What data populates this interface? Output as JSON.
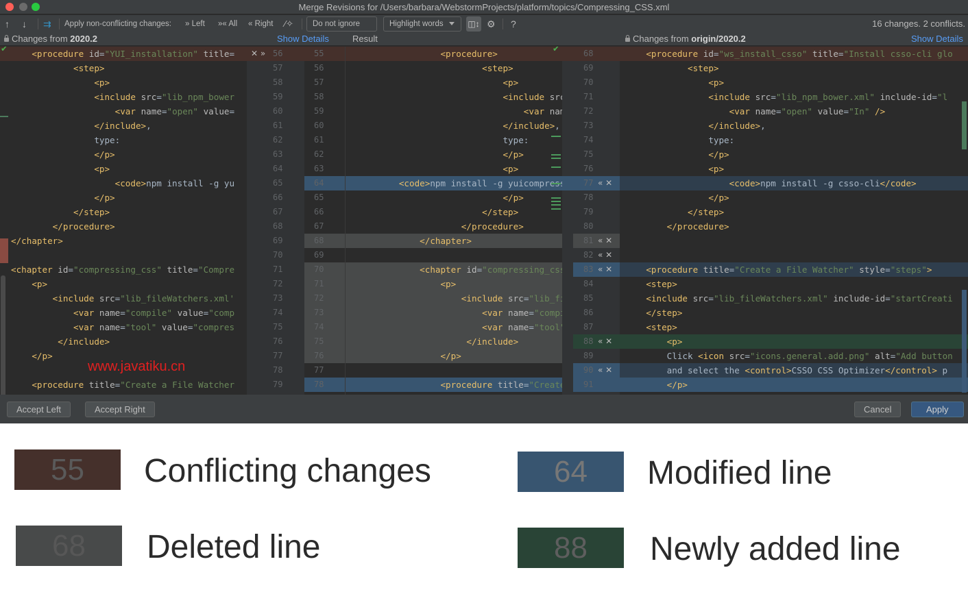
{
  "window": {
    "title": "Merge Revisions for /Users/barbara/WebstormProjects/platform/topics/Compressing_CSS.xml"
  },
  "toolbar": {
    "prev_icon": "arrow-up-icon",
    "next_icon": "arrow-down-icon",
    "magic_resolve_icon": "merge-arrows-icon",
    "apply_label": "Apply non-conflicting changes:",
    "left_label": "Left",
    "all_label": "All",
    "right_label": "Right",
    "wand_icon": "magic-wand-icon",
    "ignore_combo": "Do not ignore",
    "highlight_combo": "Highlight words",
    "sync_scroll_icon": "sync-scroll-icon",
    "settings_icon": "gear-icon",
    "help_label": "?",
    "changes_status": "16 changes. 2 conflicts."
  },
  "headers": {
    "left_prefix": "Changes from ",
    "left_branch": "2020.2",
    "left_show_details": "Show Details",
    "result_label": "Result",
    "right_prefix": "Changes from ",
    "right_branch": "origin/2020.2",
    "right_show_details": "Show Details"
  },
  "left_panel": {
    "lines": [
      {
        "ln": "56",
        "code": [
          [
            "t",
            "    <procedure"
          ],
          [
            "a",
            " id"
          ],
          [
            "p",
            "="
          ],
          [
            "s",
            "\"YUI_installation\""
          ],
          [
            "a",
            " title"
          ],
          [
            "p",
            "="
          ]
        ],
        "bg": "conflict"
      },
      {
        "ln": "57",
        "code": [
          [
            "t",
            "            <step>"
          ]
        ]
      },
      {
        "ln": "58",
        "code": [
          [
            "t",
            "                <p>"
          ]
        ]
      },
      {
        "ln": "59",
        "code": [
          [
            "t",
            "                <include"
          ],
          [
            "a",
            " src"
          ],
          [
            "p",
            "="
          ],
          [
            "s",
            "\"lib_npm_bower"
          ]
        ]
      },
      {
        "ln": "60",
        "code": [
          [
            "t",
            "                    <var"
          ],
          [
            "a",
            " name"
          ],
          [
            "p",
            "="
          ],
          [
            "s",
            "\"open\""
          ],
          [
            "a",
            " value"
          ],
          [
            "p",
            "="
          ]
        ]
      },
      {
        "ln": "61",
        "code": [
          [
            "t",
            "                </include>"
          ],
          [
            "p",
            ","
          ]
        ]
      },
      {
        "ln": "62",
        "code": [
          [
            "p",
            "                type:"
          ]
        ]
      },
      {
        "ln": "63",
        "code": [
          [
            "t",
            "                </p>"
          ]
        ]
      },
      {
        "ln": "64",
        "code": [
          [
            "t",
            "                <p>"
          ]
        ]
      },
      {
        "ln": "65",
        "code": [
          [
            "t",
            "                    <code>"
          ],
          [
            "p",
            "npm install -g yu"
          ]
        ]
      },
      {
        "ln": "66",
        "code": [
          [
            "t",
            "                </p>"
          ]
        ]
      },
      {
        "ln": "67",
        "code": [
          [
            "t",
            "            </step>"
          ]
        ]
      },
      {
        "ln": "68",
        "code": [
          [
            "t",
            "        </procedure>"
          ]
        ]
      },
      {
        "ln": "69",
        "code": [
          [
            "t",
            "</chapter>"
          ]
        ]
      },
      {
        "ln": "70",
        "code": []
      },
      {
        "ln": "71",
        "code": [
          [
            "t",
            "<chapter"
          ],
          [
            "a",
            " id"
          ],
          [
            "p",
            "="
          ],
          [
            "s",
            "\"compressing_css\""
          ],
          [
            "a",
            " title"
          ],
          [
            "p",
            "="
          ],
          [
            "s",
            "\"Compre"
          ]
        ]
      },
      {
        "ln": "72",
        "code": [
          [
            "t",
            "    <p>"
          ]
        ]
      },
      {
        "ln": "73",
        "code": [
          [
            "t",
            "        <include"
          ],
          [
            "a",
            " src"
          ],
          [
            "p",
            "="
          ],
          [
            "s",
            "\"lib_fileWatchers.xml'"
          ]
        ]
      },
      {
        "ln": "74",
        "code": [
          [
            "t",
            "            <var"
          ],
          [
            "a",
            " name"
          ],
          [
            "p",
            "="
          ],
          [
            "s",
            "\"compile\""
          ],
          [
            "a",
            " value"
          ],
          [
            "p",
            "="
          ],
          [
            "s",
            "\"comp"
          ]
        ]
      },
      {
        "ln": "75",
        "code": [
          [
            "t",
            "            <var"
          ],
          [
            "a",
            " name"
          ],
          [
            "p",
            "="
          ],
          [
            "s",
            "\"tool\""
          ],
          [
            "a",
            " value"
          ],
          [
            "p",
            "="
          ],
          [
            "s",
            "\"compres"
          ]
        ]
      },
      {
        "ln": "76",
        "code": [
          [
            "t",
            "         </include>"
          ]
        ]
      },
      {
        "ln": "77",
        "code": [
          [
            "t",
            "    </p>"
          ]
        ]
      },
      {
        "ln": "78",
        "code": []
      },
      {
        "ln": "79",
        "code": [
          [
            "t",
            "    <procedure"
          ],
          [
            "a",
            " title"
          ],
          [
            "p",
            "="
          ],
          [
            "s",
            "\"Create a File Watcher"
          ]
        ]
      }
    ]
  },
  "mid_panel": {
    "lines": [
      {
        "ln": "55",
        "code": [
          [
            "t",
            "                  <procedure>"
          ]
        ],
        "bg": "conflict"
      },
      {
        "ln": "56",
        "code": [
          [
            "t",
            "                          <step>"
          ]
        ]
      },
      {
        "ln": "57",
        "code": [
          [
            "t",
            "                              <p>"
          ]
        ]
      },
      {
        "ln": "58",
        "code": [
          [
            "t",
            "                              <include"
          ],
          [
            "a",
            " src"
          ],
          [
            "p",
            "="
          ],
          [
            "s",
            "\"l"
          ]
        ]
      },
      {
        "ln": "59",
        "code": [
          [
            "t",
            "                                  <var"
          ],
          [
            "a",
            " name"
          ],
          [
            "p",
            "="
          ],
          [
            "s",
            "\""
          ]
        ]
      },
      {
        "ln": "60",
        "code": [
          [
            "t",
            "                              </include>"
          ],
          [
            "p",
            ","
          ]
        ]
      },
      {
        "ln": "61",
        "code": [
          [
            "p",
            "                              type:"
          ]
        ]
      },
      {
        "ln": "62",
        "code": [
          [
            "t",
            "                              </p>"
          ]
        ]
      },
      {
        "ln": "63",
        "code": [
          [
            "t",
            "                              <p>"
          ]
        ]
      },
      {
        "ln": "64",
        "code": [
          [
            "t",
            "          <code>"
          ],
          [
            "p",
            "npm install -g yuicompressor"
          ],
          [
            "t",
            "</"
          ]
        ],
        "bg": "modified"
      },
      {
        "ln": "65",
        "code": [
          [
            "t",
            "                              </p>"
          ]
        ]
      },
      {
        "ln": "66",
        "code": [
          [
            "t",
            "                          </step>"
          ]
        ]
      },
      {
        "ln": "67",
        "code": [
          [
            "t",
            "                      </procedure>"
          ]
        ]
      },
      {
        "ln": "68",
        "code": [
          [
            "t",
            "              </chapter>"
          ]
        ],
        "bg": "deleted"
      },
      {
        "ln": "69",
        "code": []
      },
      {
        "ln": "70",
        "code": [
          [
            "t",
            "              <chapter"
          ],
          [
            "a",
            " id"
          ],
          [
            "p",
            "="
          ],
          [
            "s",
            "\"compressing_css\""
          ]
        ],
        "bg": "deleted"
      },
      {
        "ln": "71",
        "code": [
          [
            "t",
            "                  <p>"
          ]
        ],
        "bg": "deleted"
      },
      {
        "ln": "72",
        "code": [
          [
            "t",
            "                      <include"
          ],
          [
            "a",
            " src"
          ],
          [
            "p",
            "="
          ],
          [
            "s",
            "\"lib_fileW"
          ]
        ],
        "bg": "deleted"
      },
      {
        "ln": "73",
        "code": [
          [
            "t",
            "                          <var"
          ],
          [
            "a",
            " name"
          ],
          [
            "p",
            "="
          ],
          [
            "s",
            "\"compile\""
          ]
        ],
        "bg": "deleted"
      },
      {
        "ln": "74",
        "code": [
          [
            "t",
            "                          <var"
          ],
          [
            "a",
            " name"
          ],
          [
            "p",
            "="
          ],
          [
            "s",
            "\"tool\""
          ],
          [
            "a",
            " va"
          ]
        ],
        "bg": "deleted"
      },
      {
        "ln": "75",
        "code": [
          [
            "t",
            "                       </include>"
          ]
        ],
        "bg": "deleted"
      },
      {
        "ln": "76",
        "code": [
          [
            "t",
            "                  </p>"
          ]
        ],
        "bg": "deleted"
      },
      {
        "ln": "77",
        "code": []
      },
      {
        "ln": "78",
        "code": [
          [
            "t",
            "                  <procedure"
          ],
          [
            "a",
            " title"
          ],
          [
            "p",
            "="
          ],
          [
            "s",
            "\"Create a"
          ]
        ],
        "bg": "modified"
      }
    ]
  },
  "right_panel": {
    "lines": [
      {
        "ln": "68",
        "code": [
          [
            "t",
            "    <procedure"
          ],
          [
            "a",
            " id"
          ],
          [
            "p",
            "="
          ],
          [
            "s",
            "\"ws_install_csso\""
          ],
          [
            "a",
            " title"
          ],
          [
            "p",
            "="
          ],
          [
            "s",
            "\"Install csso-cli glo"
          ]
        ],
        "bg": "conflict"
      },
      {
        "ln": "69",
        "code": [
          [
            "t",
            "            <step>"
          ]
        ]
      },
      {
        "ln": "70",
        "code": [
          [
            "t",
            "                <p>"
          ]
        ]
      },
      {
        "ln": "71",
        "code": [
          [
            "t",
            "                <include"
          ],
          [
            "a",
            " src"
          ],
          [
            "p",
            "="
          ],
          [
            "s",
            "\"lib_npm_bower.xml\""
          ],
          [
            "a",
            " include-id"
          ],
          [
            "p",
            "="
          ],
          [
            "s",
            "\"l"
          ]
        ]
      },
      {
        "ln": "72",
        "code": [
          [
            "t",
            "                    <var"
          ],
          [
            "a",
            " name"
          ],
          [
            "p",
            "="
          ],
          [
            "s",
            "\"open\""
          ],
          [
            "a",
            " value"
          ],
          [
            "p",
            "="
          ],
          [
            "s",
            "\"In\""
          ],
          [
            "t",
            " />"
          ]
        ]
      },
      {
        "ln": "73",
        "code": [
          [
            "t",
            "                </include>"
          ],
          [
            "p",
            ","
          ]
        ]
      },
      {
        "ln": "74",
        "code": [
          [
            "p",
            "                type:"
          ]
        ]
      },
      {
        "ln": "75",
        "code": [
          [
            "t",
            "                </p>"
          ]
        ]
      },
      {
        "ln": "76",
        "code": [
          [
            "t",
            "                <p>"
          ]
        ]
      },
      {
        "ln": "77",
        "code": [
          [
            "t",
            "                    <code>"
          ],
          [
            "p",
            "npm install -g csso-cli"
          ],
          [
            "t",
            "</code>"
          ]
        ],
        "bg": "modified-soft"
      },
      {
        "ln": "78",
        "code": [
          [
            "t",
            "                </p>"
          ]
        ]
      },
      {
        "ln": "79",
        "code": [
          [
            "t",
            "            </step>"
          ]
        ]
      },
      {
        "ln": "80",
        "code": [
          [
            "t",
            "        </procedure>"
          ]
        ]
      },
      {
        "ln": "81",
        "code": []
      },
      {
        "ln": "82",
        "code": []
      },
      {
        "ln": "83",
        "code": [
          [
            "t",
            "    <procedure"
          ],
          [
            "a",
            " title"
          ],
          [
            "p",
            "="
          ],
          [
            "s",
            "\"Create a File Watcher\""
          ],
          [
            "a",
            " style"
          ],
          [
            "p",
            "="
          ],
          [
            "s",
            "\"steps\""
          ],
          [
            "t",
            ">"
          ]
        ],
        "bg": "modified-soft"
      },
      {
        "ln": "84",
        "code": [
          [
            "t",
            "    <step>"
          ]
        ]
      },
      {
        "ln": "85",
        "code": [
          [
            "t",
            "    <include"
          ],
          [
            "a",
            " src"
          ],
          [
            "p",
            "="
          ],
          [
            "s",
            "\"lib_fileWatchers.xml\""
          ],
          [
            "a",
            " include-id"
          ],
          [
            "p",
            "="
          ],
          [
            "s",
            "\"startCreati"
          ]
        ]
      },
      {
        "ln": "86",
        "code": [
          [
            "t",
            "    </step>"
          ]
        ]
      },
      {
        "ln": "87",
        "code": [
          [
            "t",
            "    <step>"
          ]
        ]
      },
      {
        "ln": "88",
        "code": [
          [
            "t",
            "        <p>"
          ]
        ],
        "bg": "added"
      },
      {
        "ln": "89",
        "code": [
          [
            "p",
            "        Click "
          ],
          [
            "t",
            "<icon"
          ],
          [
            "a",
            " src"
          ],
          [
            "p",
            "="
          ],
          [
            "s",
            "\"icons.general.add.png\""
          ],
          [
            "a",
            " alt"
          ],
          [
            "p",
            "="
          ],
          [
            "s",
            "\"Add button"
          ]
        ]
      },
      {
        "ln": "90",
        "code": [
          [
            "p",
            "        and select the "
          ],
          [
            "t",
            "<control>"
          ],
          [
            "p",
            "CSSO CSS Optimizer"
          ],
          [
            "t",
            "</control>"
          ],
          [
            "p",
            " p"
          ]
        ],
        "bg": "modified-soft"
      },
      {
        "ln": "91",
        "code": [
          [
            "t",
            "        </p>"
          ]
        ],
        "bg": "modified"
      }
    ]
  },
  "left_gutter_controls": [
    {
      "row": 0,
      "label": "✕ »"
    }
  ],
  "right_gutter_controls": [
    {
      "row": 9,
      "label": "« ✕"
    },
    {
      "row": 13,
      "label": "« ✕"
    },
    {
      "row": 14,
      "label": "« ✕"
    },
    {
      "row": 15,
      "label": "« ✕"
    },
    {
      "row": 20,
      "label": "« ✕"
    },
    {
      "row": 22,
      "label": "« ✕"
    }
  ],
  "buttons": {
    "accept_left": "Accept Left",
    "accept_right": "Accept Right",
    "cancel": "Cancel",
    "apply": "Apply"
  },
  "watermark": "www.javatiku.cn",
  "colors": {
    "conflict": "#45302b",
    "modified": "#385570",
    "deleted": "#484a4a",
    "added": "#294436",
    "accent_link": "#589df6"
  },
  "legend": [
    {
      "number": "55",
      "label": "Conflicting changes",
      "color": "#45302b"
    },
    {
      "number": "64",
      "label": "Modified line",
      "color": "#385570"
    },
    {
      "number": "68",
      "label": "Deleted line",
      "color": "#484a4a"
    },
    {
      "number": "88",
      "label": "Newly added line",
      "color": "#294436"
    }
  ]
}
